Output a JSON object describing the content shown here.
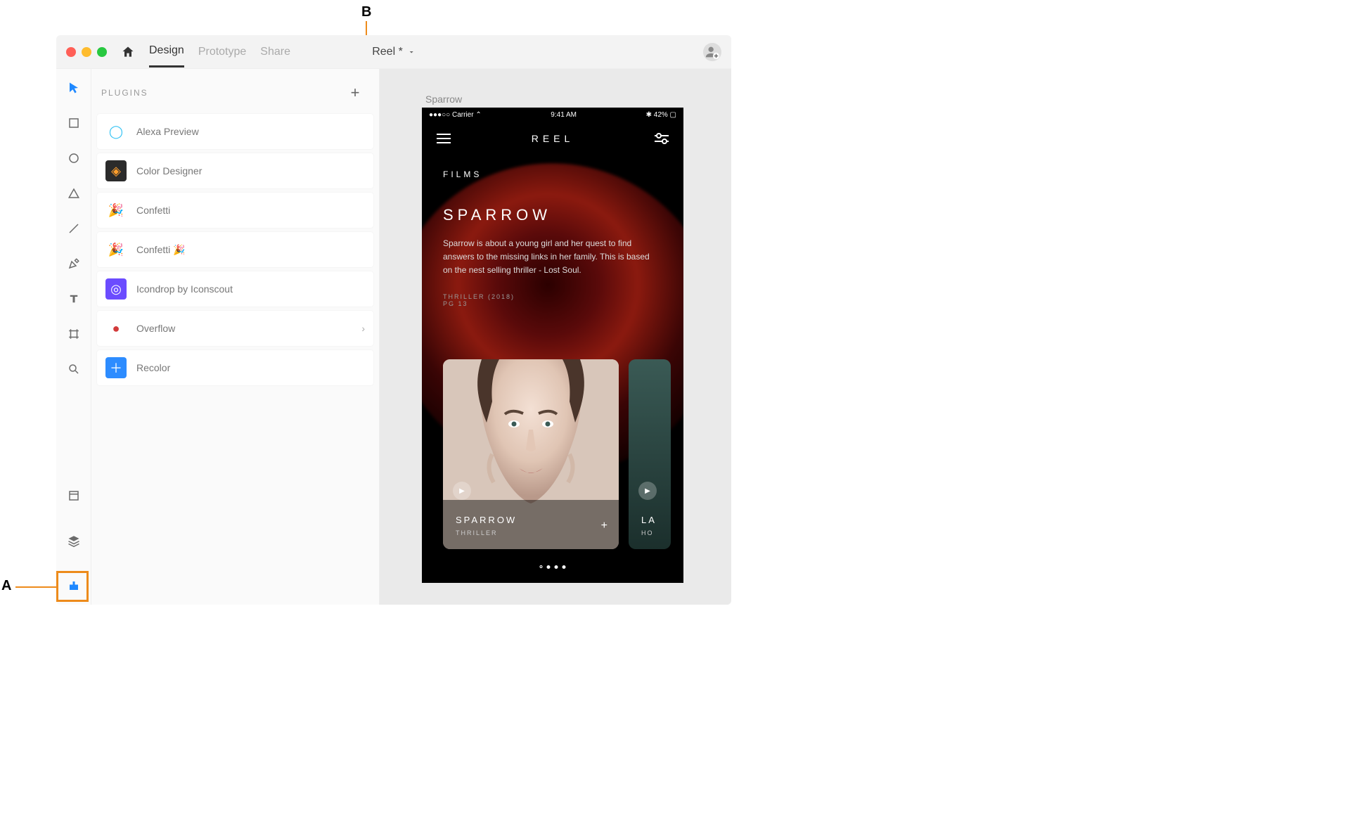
{
  "callouts": {
    "a": "A",
    "b": "B"
  },
  "titlebar": {
    "tabs": [
      "Design",
      "Prototype",
      "Share"
    ],
    "active_tab": 0,
    "doc_title": "Reel *"
  },
  "plugins_panel": {
    "header": "PLUGINS",
    "items": [
      {
        "name": "Alexa Preview",
        "icon_bg": "#ffffff",
        "icon_fg": "#34c3f4",
        "glyph": "◯",
        "has_sub": false
      },
      {
        "name": "Color Designer",
        "icon_bg": "#2b2b2b",
        "icon_fg": "#ff9e2c",
        "glyph": "◈",
        "has_sub": false
      },
      {
        "name": "Confetti",
        "icon_bg": "#ffffff",
        "icon_fg": "#b060e0",
        "glyph": "🎉",
        "has_sub": false
      },
      {
        "name": "Confetti 🎉",
        "icon_bg": "#ffffff",
        "icon_fg": "#b060e0",
        "glyph": "🎉",
        "has_sub": false
      },
      {
        "name": "Icondrop by Iconscout",
        "icon_bg": "#6b4cff",
        "icon_fg": "#ffffff",
        "glyph": "◎",
        "has_sub": false
      },
      {
        "name": "Overflow",
        "icon_bg": "#ffffff",
        "icon_fg": "#d23a3a",
        "glyph": "●",
        "has_sub": true
      },
      {
        "name": "Recolor",
        "icon_bg": "#2d8cff",
        "icon_fg": "#ffffff",
        "glyph": "＋",
        "has_sub": false
      }
    ]
  },
  "canvas": {
    "artboard_label": "Sparrow"
  },
  "mock": {
    "status_left": "●●●○○ Carrier ⌃",
    "status_time": "9:41 AM",
    "status_right": "✱ 42% ▢",
    "brand": "REEL",
    "films_label": "FILMS",
    "hero_title": "SPARROW",
    "hero_desc": "Sparrow is about a young girl and her quest to find answers to the missing links in her family. This is based on the nest selling thriller - Lost Soul.",
    "hero_meta1": "THRILLER (2018)",
    "hero_meta2": "PG 13",
    "card1_title": "SPARROW",
    "card1_sub": "THRILLER",
    "card2_title": "LA",
    "card2_sub": "HO"
  }
}
